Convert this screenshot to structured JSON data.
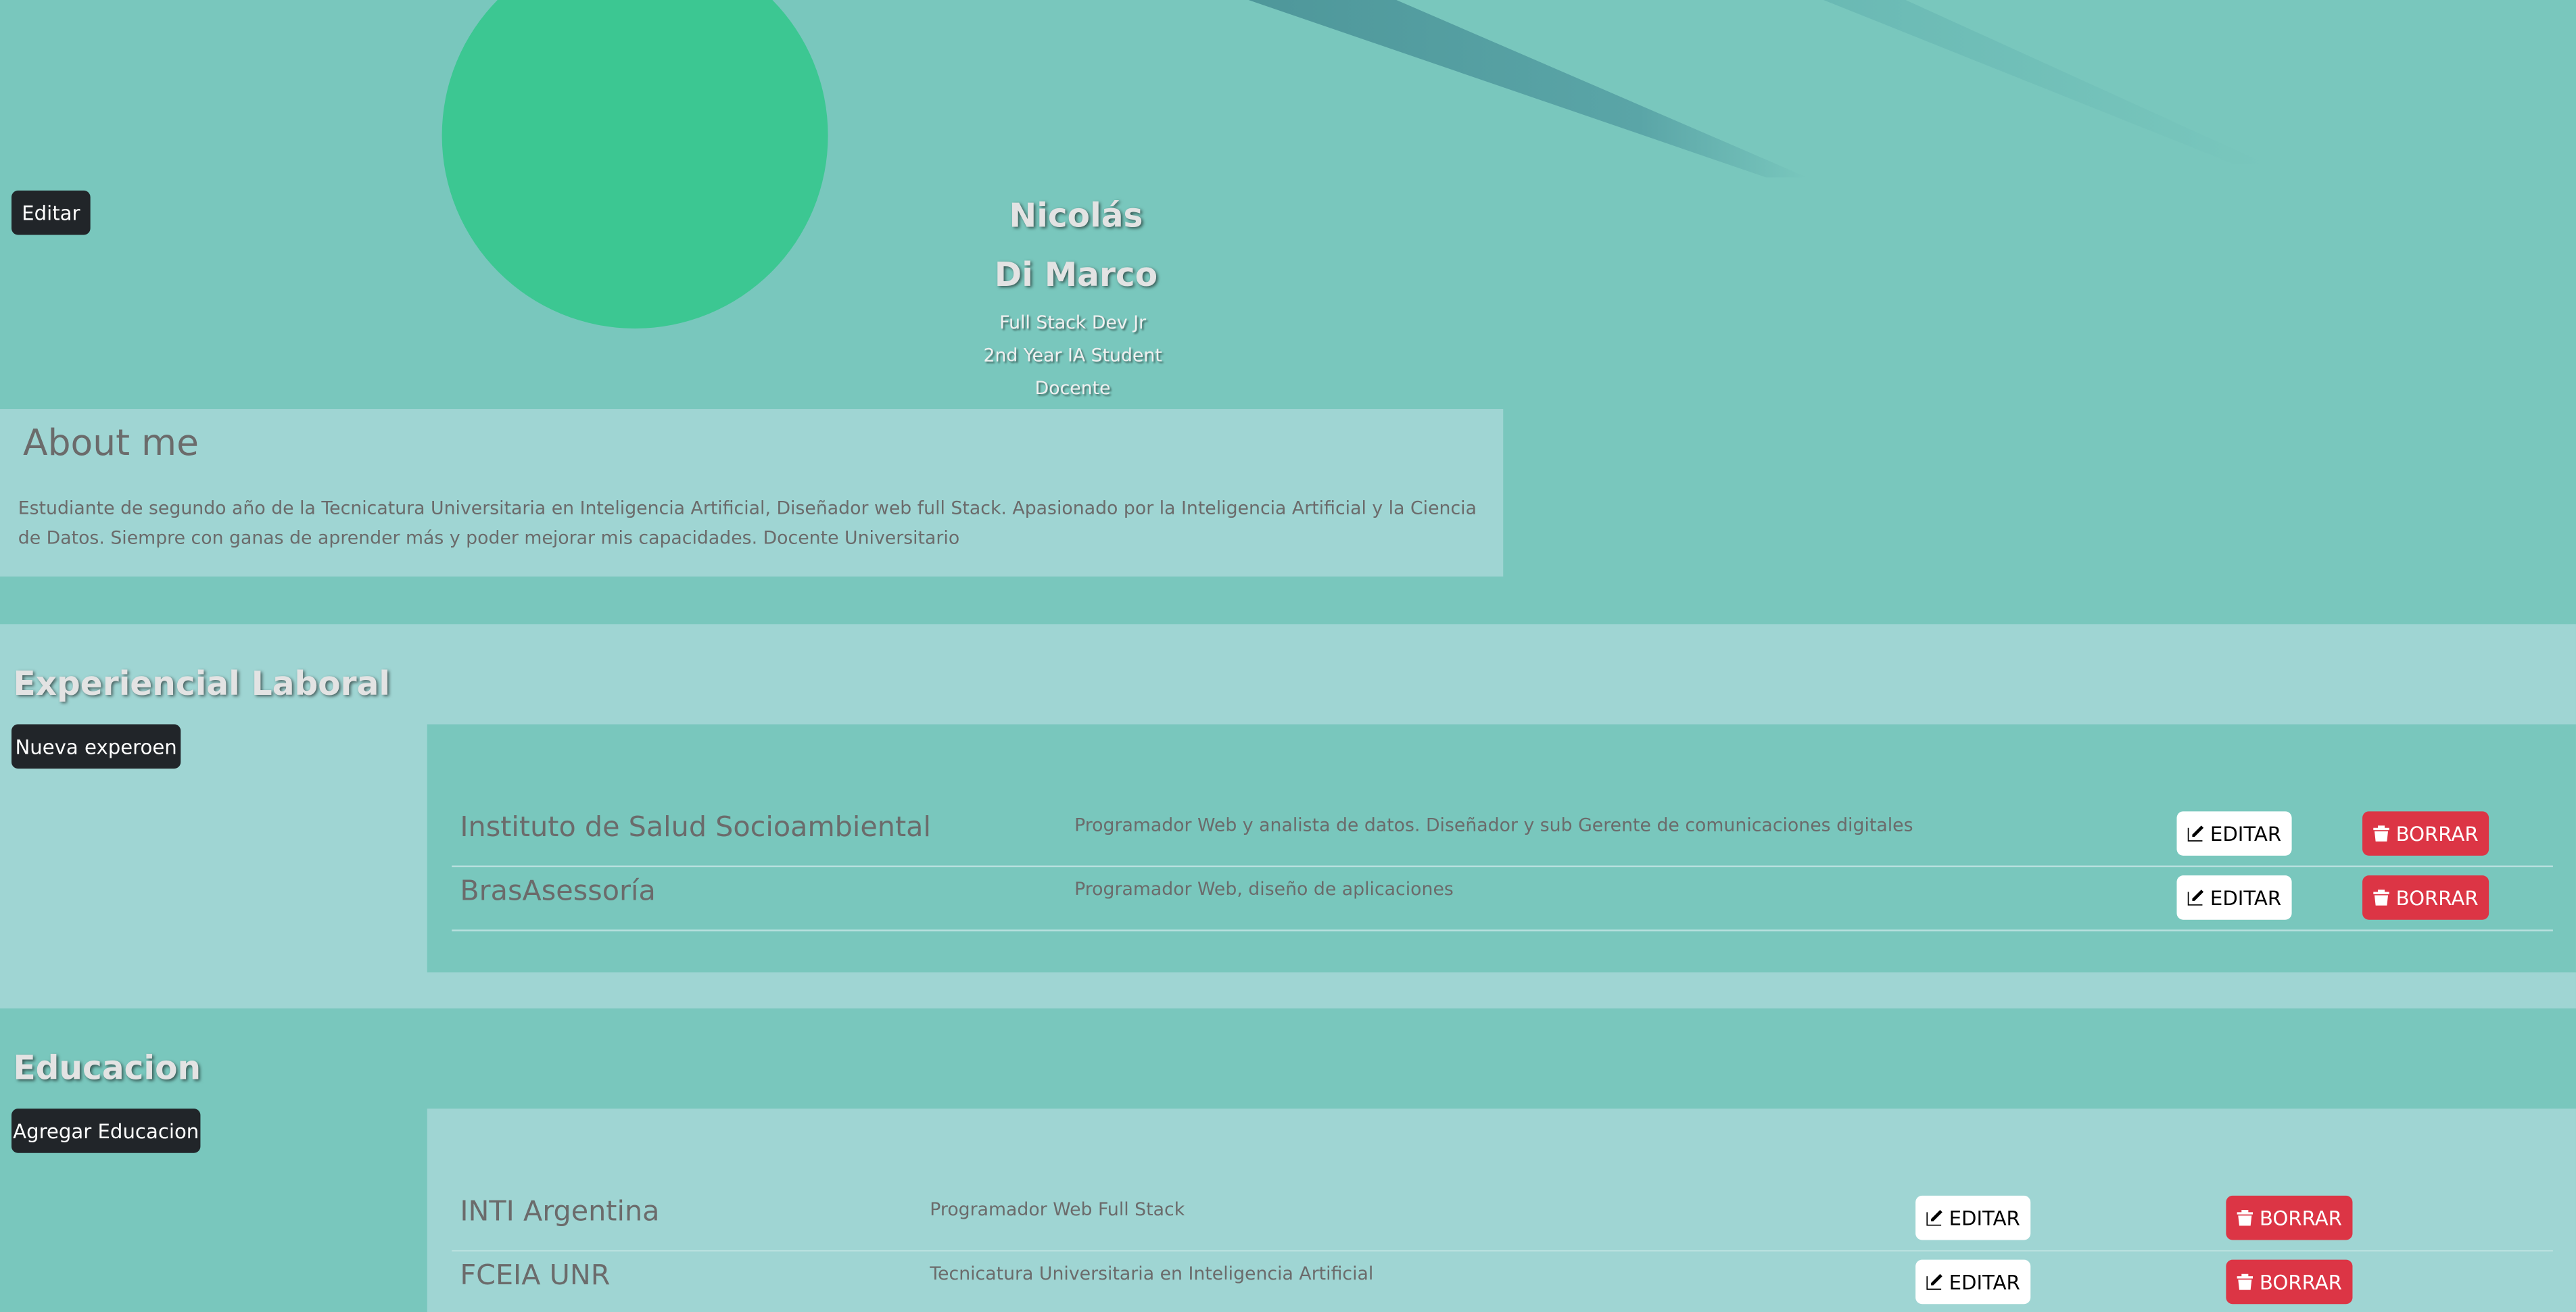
{
  "profile": {
    "edit_label": "Editar",
    "first_name": "Nicolás",
    "last_name": "Di Marco",
    "subtitles": [
      "Full Stack Dev Jr",
      "2nd Year IA Student",
      "Docente"
    ]
  },
  "about": {
    "title": "About me",
    "text": "Estudiante de segundo año de la Tecnicatura Universitaria en Inteligencia Artificial, Diseñador web full Stack. Apasionado por la Inteligencia Artificial y la Ciencia de Datos. Siempre con ganas de aprender más y poder mejorar mis capacidades. Docente Universitario"
  },
  "experience": {
    "title": "Experiencial Laboral",
    "add_label": "Nueva experoen",
    "items": [
      {
        "name": "Instituto de Salud Socioambiental",
        "desc": "Programador Web y analista de datos. Diseñador y sub Gerente de comunicaciones digitales"
      },
      {
        "name": "BrasAsessoría",
        "desc": "Programador Web, diseño de aplicaciones"
      }
    ]
  },
  "education": {
    "title": "Educacion",
    "add_label": "Agregar Educacion",
    "items": [
      {
        "name": "INTI Argentina",
        "desc": "Programador Web Full Stack"
      },
      {
        "name": "FCEIA UNR",
        "desc": "Tecnicatura Universitaria en Inteligencia Artificial"
      }
    ]
  },
  "actions": {
    "edit_label": "EDITAR",
    "delete_label": "BORRAR"
  },
  "colors": {
    "background": "#79c7bd",
    "panel_light": "#9fd5d3",
    "avatar": "#3cc792",
    "danger": "#dc3545",
    "dark": "#212529"
  }
}
